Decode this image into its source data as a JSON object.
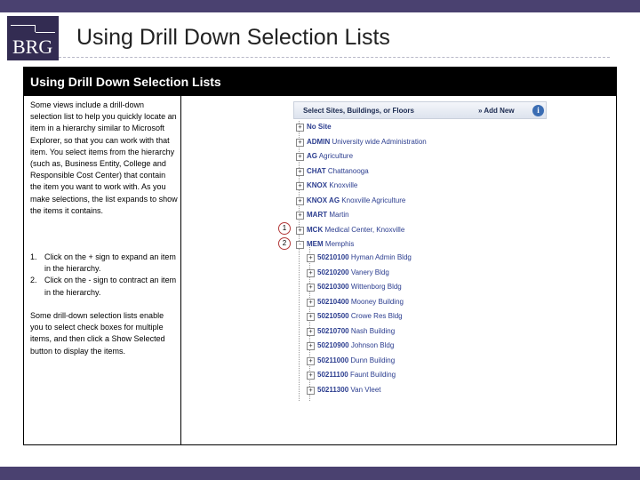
{
  "slide": {
    "logo_text": "BRG",
    "title": "Using Drill Down Selection Lists",
    "panel_title": "Using Drill Down Selection Lists"
  },
  "left": {
    "intro": "Some views include a drill-down selection list to help you quickly locate an item in a hierarchy similar to Microsoft Explorer, so that you can work with that item. You select items from the hierarchy (such as, Business Entity, College and Responsible Cost Center) that contain the item you want to work with. As you make selections, the list expands to show the items it contains.",
    "steps": [
      {
        "num": "1.",
        "text": "Click on the + sign to expand an item in the hierarchy."
      },
      {
        "num": "2.",
        "text": "Click on the - sign to contract an item in the hierarchy."
      }
    ],
    "outro": "Some drill-down selection lists enable you to select check boxes for multiple items, and then click a Show Selected button to display the items."
  },
  "screenshot": {
    "header_title": "Select Sites, Buildings, or Floors",
    "add_new": "» Add New",
    "help_icon": "help-icon",
    "colors": {
      "link": "#2b3d8f",
      "callout": "#b33a3a"
    },
    "top_items": [
      {
        "code": "No Site",
        "name": ""
      },
      {
        "code": "ADMIN",
        "name": "University wide Administration"
      },
      {
        "code": "AG",
        "name": "Agriculture"
      },
      {
        "code": "CHAT",
        "name": "Chattanooga"
      },
      {
        "code": "KNOX",
        "name": "Knoxville"
      },
      {
        "code": "KNOX AG",
        "name": "Knoxville Agriculture"
      },
      {
        "code": "MART",
        "name": "Martin"
      },
      {
        "code": "MCK",
        "name": "Medical Center, Knoxville"
      },
      {
        "code": "MEM",
        "name": "Memphis"
      }
    ],
    "sub_items": [
      {
        "code": "50210100",
        "name": "Hyman Admin Bldg"
      },
      {
        "code": "50210200",
        "name": "Vanery Bldg"
      },
      {
        "code": "50210300",
        "name": "Wittenborg Bldg"
      },
      {
        "code": "50210400",
        "name": "Mooney Building"
      },
      {
        "code": "50210500",
        "name": "Crowe Res Bldg"
      },
      {
        "code": "50210700",
        "name": "Nash Building"
      },
      {
        "code": "50210900",
        "name": "Johnson Bldg"
      },
      {
        "code": "50211000",
        "name": "Dunn Building"
      },
      {
        "code": "50211100",
        "name": "Faunt Building"
      },
      {
        "code": "50211300",
        "name": "Van Vleet"
      }
    ],
    "callouts": [
      "1",
      "2"
    ]
  }
}
